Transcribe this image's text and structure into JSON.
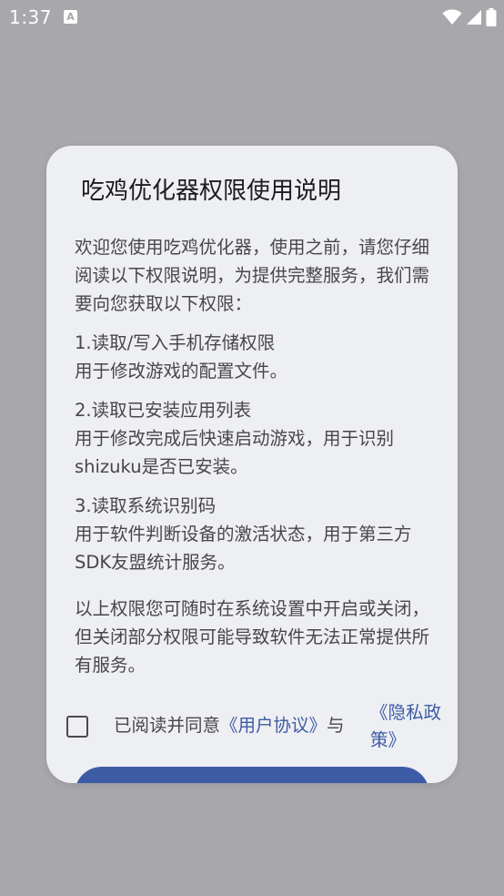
{
  "status_bar": {
    "time": "1:37",
    "notification_icon": "text-a-notification-icon"
  },
  "dialog": {
    "title": "吃鸡优化器权限使用说明",
    "intro": "欢迎您使用吃鸡优化器，使用之前，请您仔细阅读以下权限说明，为提供完整服务，我们需要向您获取以下权限：",
    "permissions": [
      {
        "title": "1.读取/写入手机存储权限",
        "desc": "用于修改游戏的配置文件。"
      },
      {
        "title": "2.读取已安装应用列表",
        "desc": "用于修改完成后快速启动游戏，用于识别shizuku是否已安装。"
      },
      {
        "title": "3.读取系统识别码",
        "desc": "用于软件判断设备的激活状态，用于第三方SDK友盟统计服务。"
      }
    ],
    "footer_note": "以上权限您可随时在系统设置中开启或关闭，但关闭部分权限可能导致软件无法正常提供所有服务。",
    "consent": {
      "prefix": "已阅读并同意",
      "user_agreement": "《用户协议》",
      "conjunction": "与",
      "privacy_policy": "《隐私政策》",
      "checked": false
    }
  },
  "colors": {
    "scrim": "#a8a7ab",
    "dialog_bg": "#eeeff3",
    "accent": "#3d5ba5",
    "body_text": "#47464c",
    "title_text": "#1c1b1f"
  }
}
